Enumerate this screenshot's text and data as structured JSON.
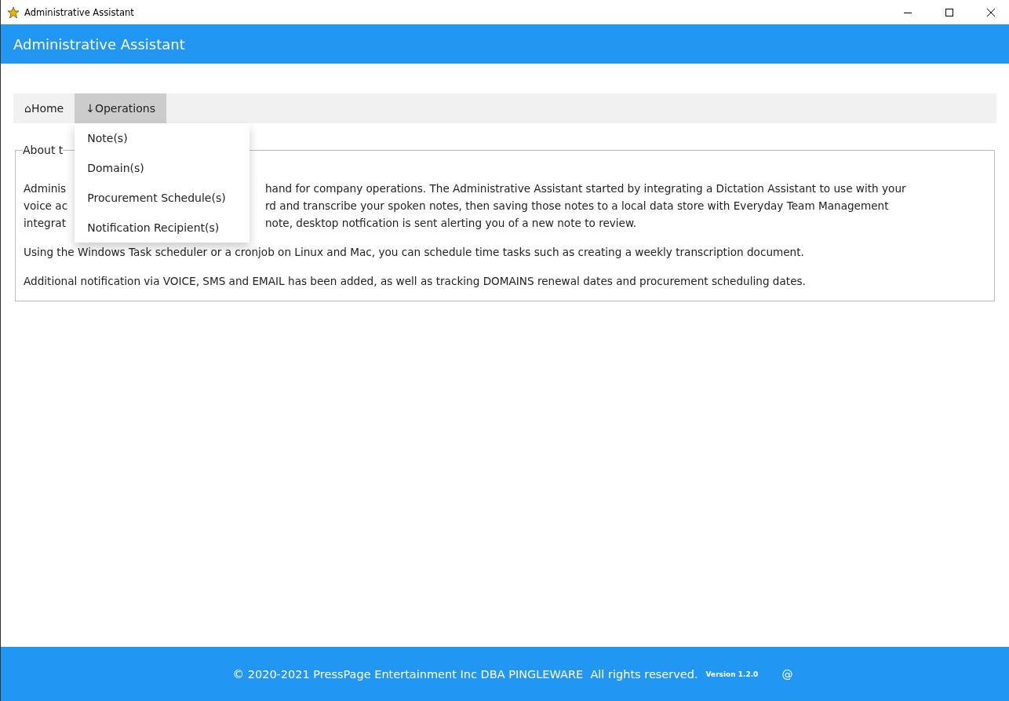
{
  "window": {
    "title": "Administrative Assistant"
  },
  "header": {
    "title": "Administrative Assistant"
  },
  "nav": {
    "tabs": [
      {
        "label": "⌂Home",
        "selected": false
      },
      {
        "label": "↓Operations",
        "selected": true,
        "menu": [
          "Note(s)",
          "Domain(s)",
          "Procurement Schedule(s)",
          "Notification Recipient(s)"
        ]
      }
    ]
  },
  "about": {
    "legend": "About t",
    "intro_lines": [
      {
        "left": "Adminis",
        "right": "hand for company operations. The Administrative Assistant started by integrating a Dictation Assistant to use with your"
      },
      {
        "left": "voice ac",
        "right": "rd and transcribe your spoken notes, then saving those notes to a local data store with Everyday Team Management"
      },
      {
        "left": "integrat",
        "right": "note, desktop notfication is sent alerting you of a new note to review."
      }
    ],
    "paragraphs": [
      "Using the Windows Task scheduler or a cronjob on Linux and Mac, you can schedule time tasks such as creating a weekly transcription document.",
      "Additional notification via VOICE, SMS and EMAIL has been added, as well as tracking DOMAINS renewal dates and procurement scheduling dates."
    ]
  },
  "footer": {
    "copyright": "© 2020-2021 PressPage Entertainment Inc DBA PINGLEWARE  All rights reserved.",
    "version": "Version 1.2.0",
    "contact": "@"
  }
}
